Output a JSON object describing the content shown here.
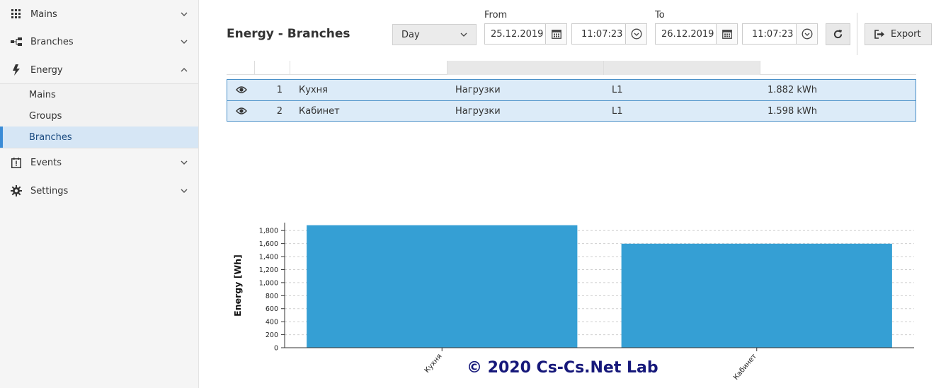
{
  "sidebar": {
    "items": [
      {
        "label": "Mains",
        "icon": "grid-icon"
      },
      {
        "label": "Branches",
        "icon": "branches-icon"
      },
      {
        "label": "Energy",
        "icon": "lightning-icon"
      },
      {
        "label": "Events",
        "icon": "events-icon"
      },
      {
        "label": "Settings",
        "icon": "gear-icon"
      }
    ],
    "energy_subitems": [
      {
        "label": "Mains"
      },
      {
        "label": "Groups"
      },
      {
        "label": "Branches"
      }
    ]
  },
  "header": {
    "title": "Energy - Branches",
    "period": "Day",
    "from_label": "From",
    "to_label": "To",
    "from_date": "25.12.2019",
    "from_time": "11:07:23",
    "to_date": "26.12.2019",
    "to_time": "11:07:23",
    "export_label": "Export"
  },
  "table": {
    "rows": [
      {
        "num": "1",
        "name": "Кухня",
        "type": "Нагрузки",
        "phase": "L1",
        "energy": "1.882 kWh"
      },
      {
        "num": "2",
        "name": "Кабинет",
        "type": "Нагрузки",
        "phase": "L1",
        "energy": "1.598 kWh"
      }
    ]
  },
  "colors": {
    "bar": "#359fd4",
    "row_bg": "#dcebf8",
    "row_border": "#4a90c8",
    "active_accent": "#3a8bd6",
    "copyright": "#16187a"
  },
  "chart_data": {
    "type": "bar",
    "categories": [
      "Кухня",
      "Кабинет"
    ],
    "values": [
      1882,
      1598
    ],
    "ylabel": "Energy [Wh]",
    "xlabel": "",
    "ylim": [
      0,
      1900
    ],
    "yticks": [
      0,
      200,
      400,
      600,
      800,
      1000,
      1200,
      1400,
      1600,
      1800
    ],
    "ytick_labels": [
      "0",
      "200",
      "400",
      "600",
      "800",
      "1,000",
      "1,200",
      "1,400",
      "1,600",
      "1,800"
    ],
    "grid": true
  },
  "footer": {
    "copyright": "© 2020 Cs-Cs.Net Lab"
  }
}
